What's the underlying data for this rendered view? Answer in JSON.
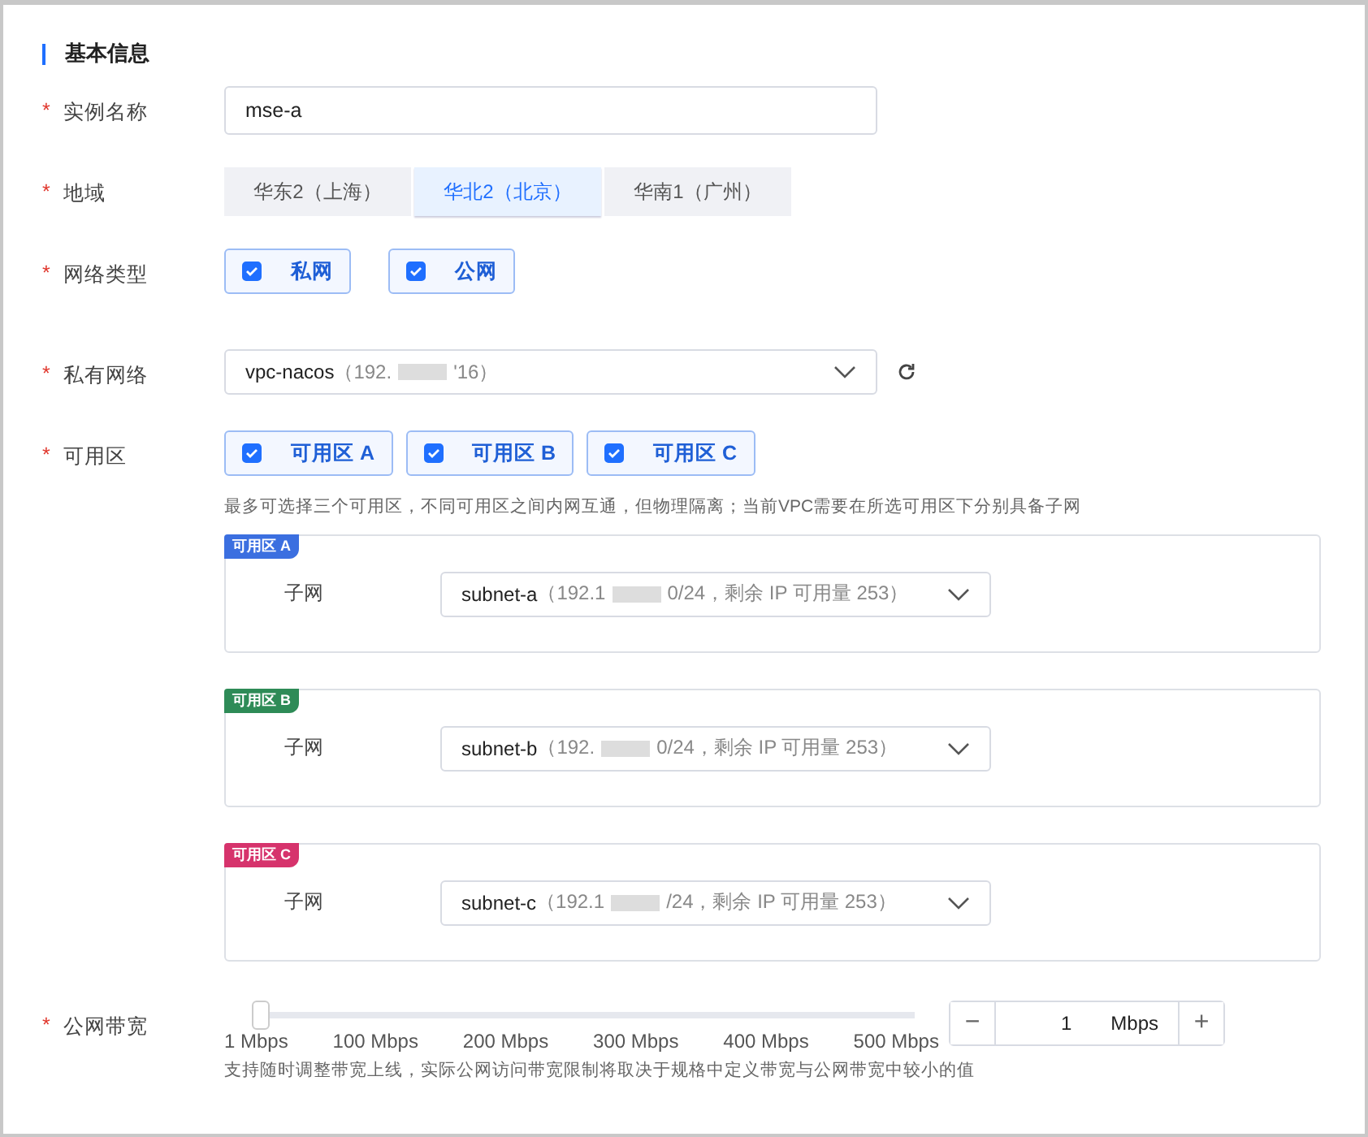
{
  "section_title": "基本信息",
  "instance_name": {
    "label": "实例名称",
    "mark": "*",
    "value": "mse-a"
  },
  "region": {
    "label": "地域",
    "mark": "*",
    "options": [
      {
        "label": "华东2（上海）",
        "selected": false
      },
      {
        "label": "华北2（北京）",
        "selected": true
      },
      {
        "label": "华南1（广州）",
        "selected": false
      }
    ]
  },
  "network_type": {
    "label": "网络类型",
    "mark": "*",
    "options": [
      {
        "label": "私网",
        "checked": true
      },
      {
        "label": "公网",
        "checked": true
      }
    ]
  },
  "vpc": {
    "label": "私有网络",
    "mark": "*",
    "value": "vpc-nacos",
    "detail_prefix": "（192.",
    "detail_suffix": "'16）"
  },
  "zones": {
    "label": "可用区",
    "mark": "*",
    "options": [
      {
        "label": "可用区 A",
        "checked": true
      },
      {
        "label": "可用区 B",
        "checked": true
      },
      {
        "label": "可用区 C",
        "checked": true
      }
    ],
    "hint": "最多可选择三个可用区，不同可用区之间内网互通，但物理隔离；当前VPC需要在所选可用区下分别具备子网"
  },
  "zone_cards": [
    {
      "tag": "可用区 A",
      "color": "#3b6fe0",
      "label": "子网",
      "value": "subnet-a",
      "detail_prefix": "（192.1",
      "detail_suffix": "0/24，剩余 IP 可用量 253）"
    },
    {
      "tag": "可用区 B",
      "color": "#2e8b57",
      "label": "子网",
      "value": "subnet-b",
      "detail_prefix": "（192.",
      "detail_suffix": "0/24，剩余 IP 可用量 253）"
    },
    {
      "tag": "可用区 C",
      "color": "#d6336c",
      "label": "子网",
      "value": "subnet-c",
      "detail_prefix": "（192.1",
      "detail_suffix": "/24，剩余 IP 可用量 253）"
    }
  ],
  "bandwidth": {
    "label": "公网带宽",
    "mark": "*",
    "level": 0,
    "ticks": [
      "1 Mbps",
      "100 Mbps",
      "200 Mbps",
      "300 Mbps",
      "400 Mbps",
      "500 Mbps"
    ],
    "stepper": {
      "minus": "−",
      "value": "1",
      "unit": "Mbps",
      "plus": "+"
    },
    "hint": "支持随时调整带宽上线，实际公网访问带宽限制将取决于规格中定义带宽与公网带宽中较小的值"
  }
}
